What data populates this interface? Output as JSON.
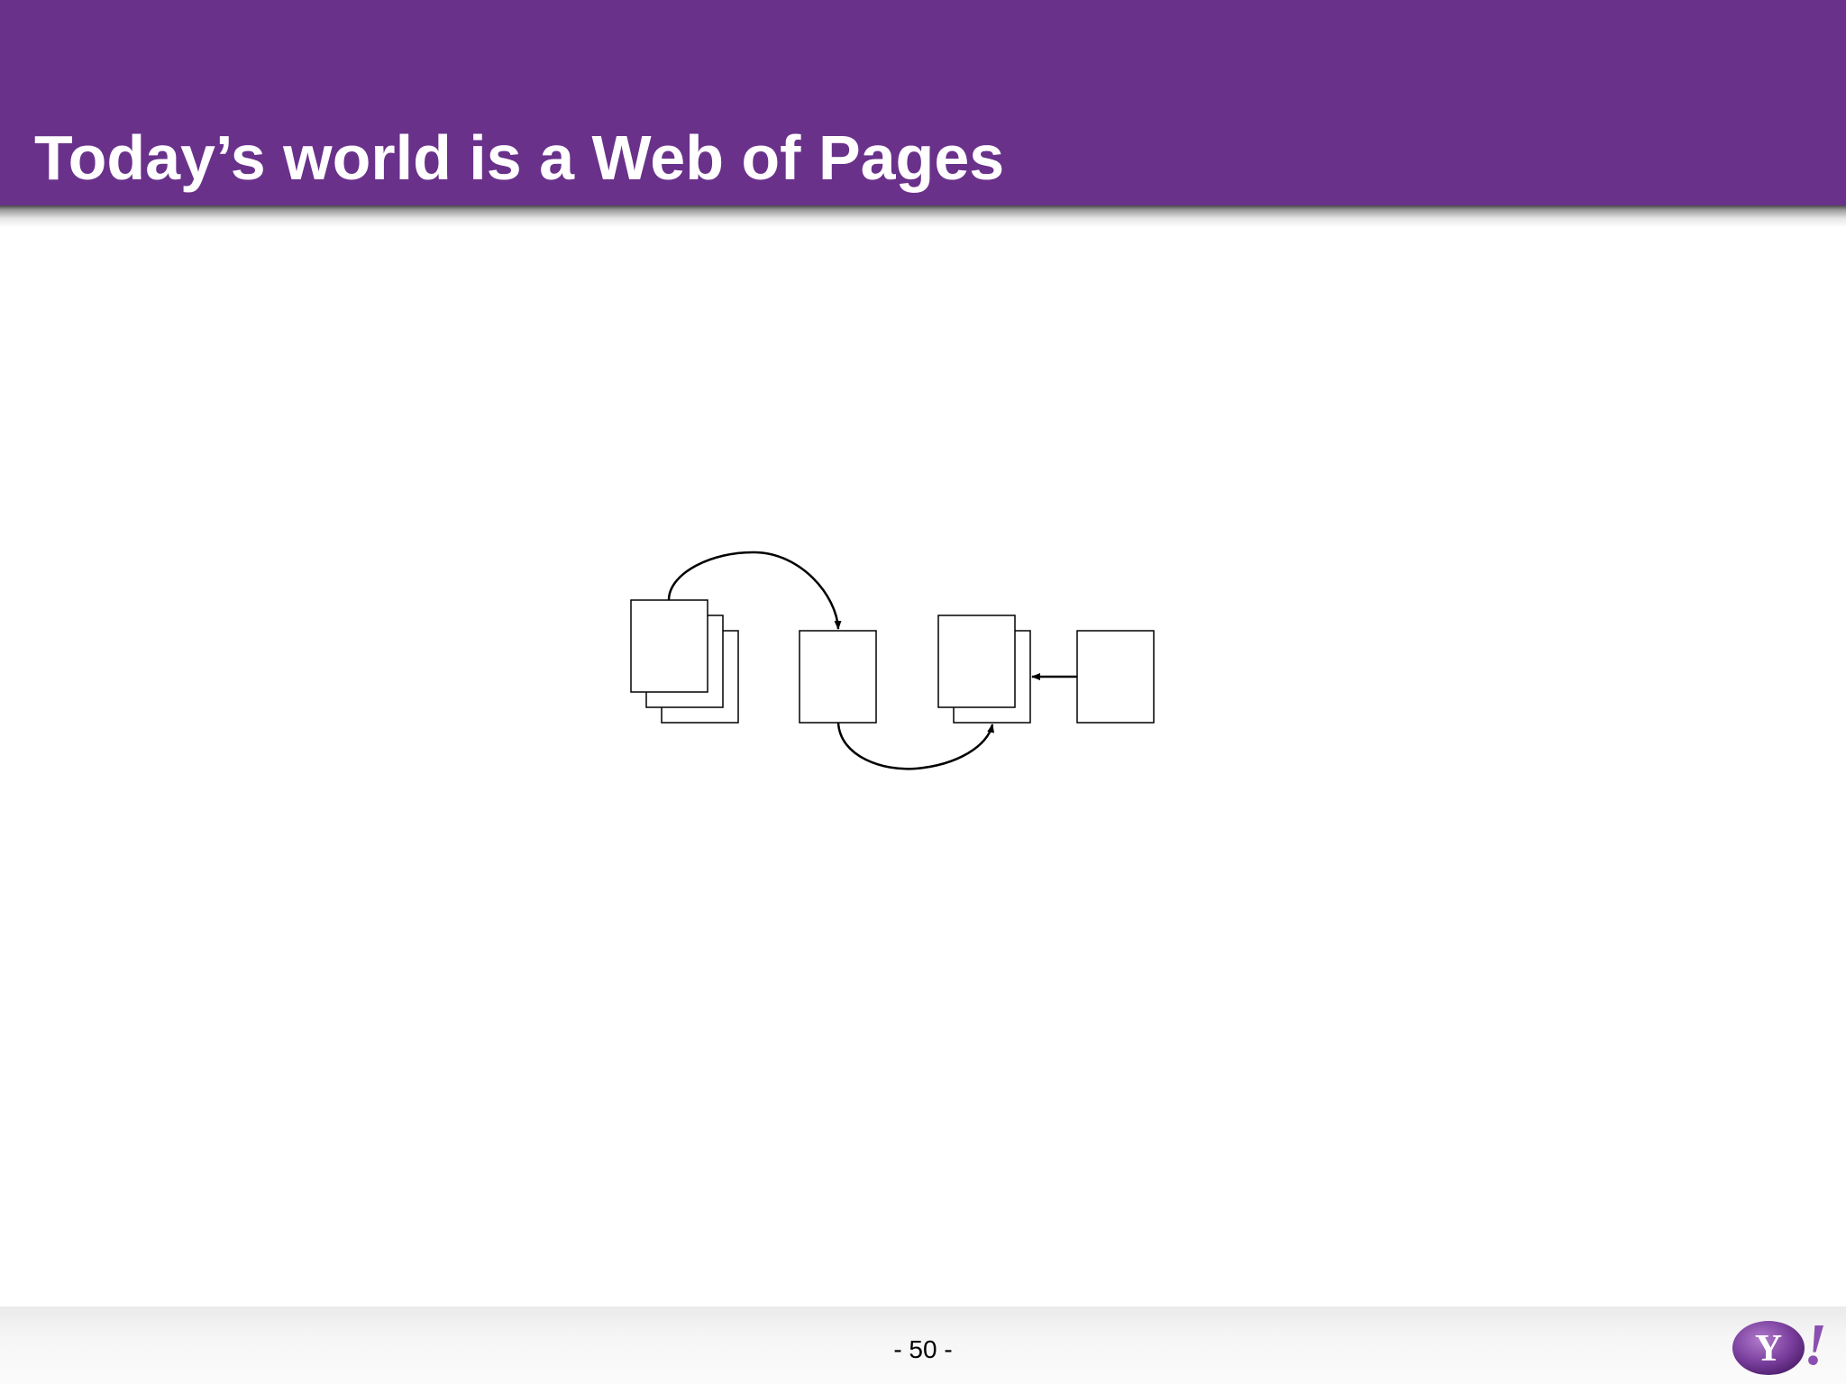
{
  "slide": {
    "title": "Today’s world is a Web of Pages",
    "page_number": "- 50 -"
  },
  "logo": {
    "name": "yahoo-logo",
    "lettering": "Y!"
  },
  "colors": {
    "header": "#6a318b",
    "title_text": "#ffffff",
    "diagram_stroke": "#000000",
    "logo_purple": "#7b3f9e"
  },
  "diagram": {
    "nodes": [
      {
        "id": "page-stack-1",
        "pages": 3
      },
      {
        "id": "page-2",
        "pages": 1
      },
      {
        "id": "page-stack-3",
        "pages": 2
      },
      {
        "id": "page-4",
        "pages": 1
      }
    ],
    "edges": [
      {
        "from": "page-stack-1",
        "to": "page-2",
        "shape": "curved-over"
      },
      {
        "from": "page-2",
        "to": "page-stack-3",
        "shape": "curved-under"
      },
      {
        "from": "page-4",
        "to": "page-stack-3",
        "shape": "straight"
      }
    ]
  }
}
